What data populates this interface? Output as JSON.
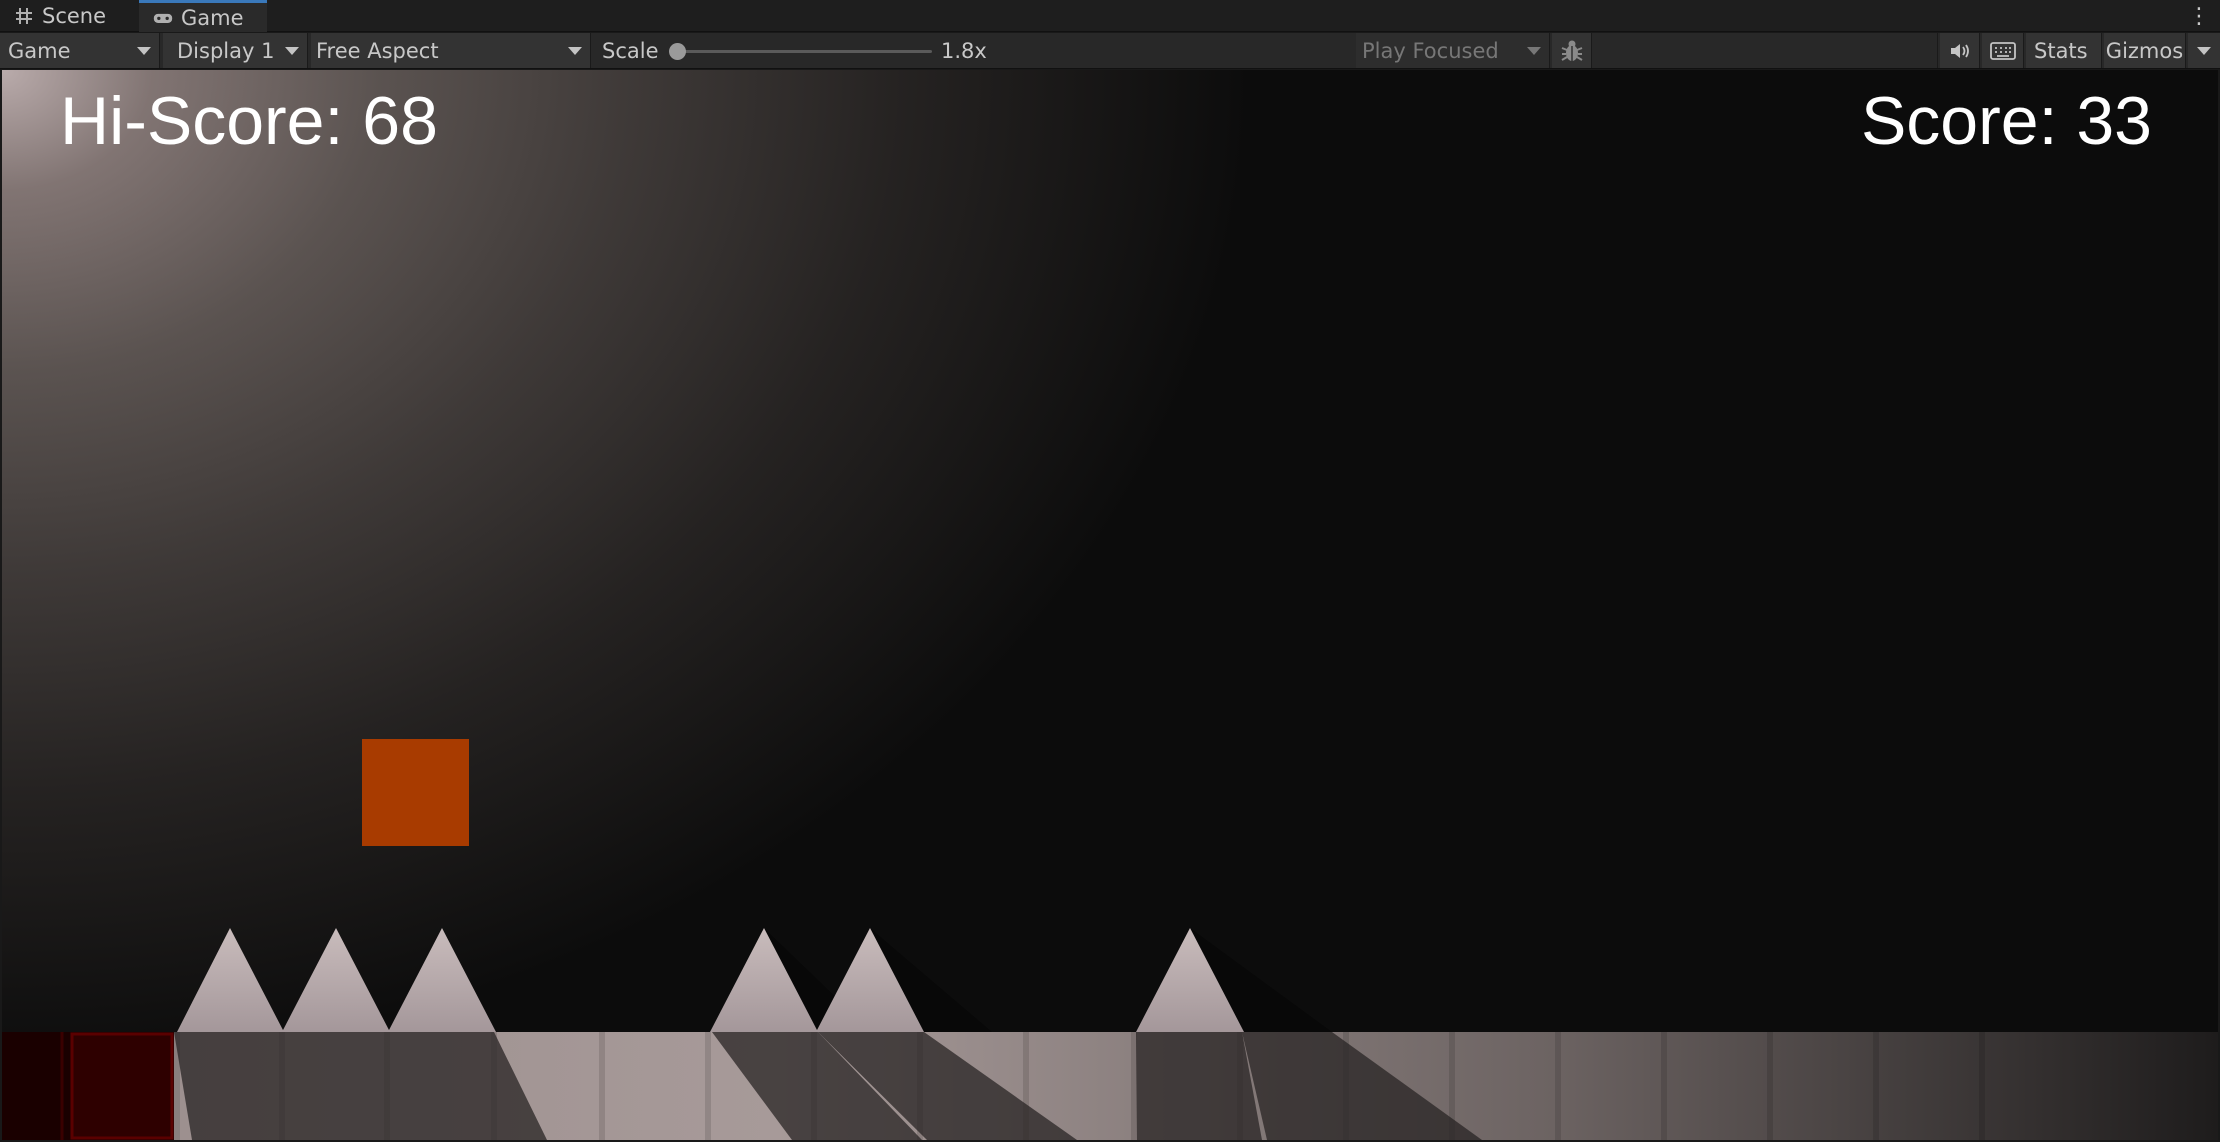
{
  "tabs": [
    {
      "label": "Scene",
      "icon": "grid-icon"
    },
    {
      "label": "Game",
      "icon": "gamepad-icon",
      "active": true
    }
  ],
  "toolbar": {
    "view_mode": "Game",
    "display": "Display 1",
    "aspect": "Free Aspect",
    "scale_label": "Scale",
    "scale_value": "1.8x",
    "play_mode": "Play Focused",
    "stats_label": "Stats",
    "gizmos_label": "Gizmos"
  },
  "hud": {
    "hi_score": "Hi-Score: 68",
    "score": "Score: 33"
  },
  "colors": {
    "player": "#a83b00",
    "spike": "#b4a5a5",
    "ground": "#8a7e7d",
    "hazard": "#2a0000"
  }
}
